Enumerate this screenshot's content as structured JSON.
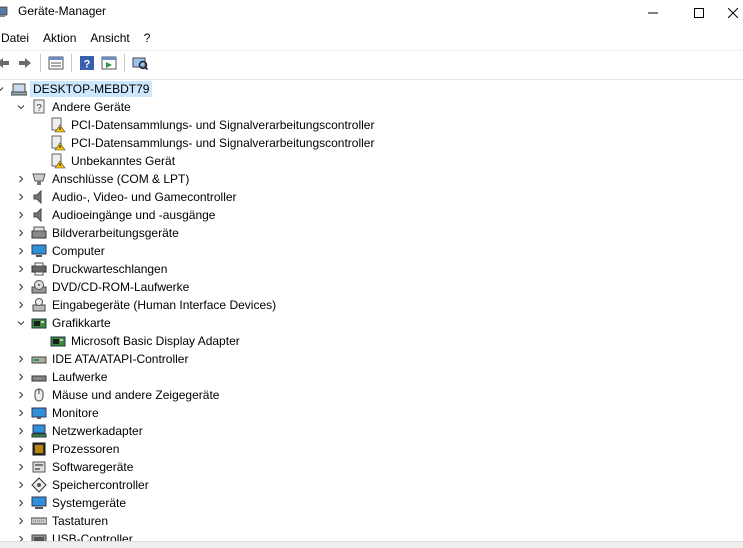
{
  "window": {
    "title": "Geräte-Manager",
    "min_symbol": "—",
    "max_symbol": "☐",
    "close_symbol": "✕"
  },
  "menu": {
    "items": [
      "Datei",
      "Aktion",
      "Ansicht",
      "?"
    ]
  },
  "toolbar": {
    "buttons": [
      "back-arrow-icon",
      "forward-arrow-icon",
      "properties-icon",
      "help-icon",
      "update-driver-icon",
      "scan-hardware-icon"
    ]
  },
  "tree": {
    "root": "DESKTOP-MEBDT79",
    "nodes": [
      {
        "label": "Andere Geräte",
        "expanded": true,
        "icon": "unknown-devices-icon",
        "children": [
          {
            "label": "PCI-Datensammlungs- und Signalverarbeitungscontroller",
            "icon": "warning-device-icon"
          },
          {
            "label": "PCI-Datensammlungs- und Signalverarbeitungscontroller",
            "icon": "warning-device-icon"
          },
          {
            "label": "Unbekanntes Gerät",
            "icon": "warning-device-icon"
          }
        ]
      },
      {
        "label": "Anschlüsse (COM & LPT)",
        "expanded": false,
        "icon": "port-icon"
      },
      {
        "label": "Audio-, Video- und Gamecontroller",
        "expanded": false,
        "icon": "speaker-icon"
      },
      {
        "label": "Audioeingänge und -ausgänge",
        "expanded": false,
        "icon": "speaker-icon"
      },
      {
        "label": "Bildverarbeitungsgeräte",
        "expanded": false,
        "icon": "scanner-icon"
      },
      {
        "label": "Computer",
        "expanded": false,
        "icon": "computer-icon"
      },
      {
        "label": "Druckwarteschlangen",
        "expanded": false,
        "icon": "printer-icon"
      },
      {
        "label": "DVD/CD-ROM-Laufwerke",
        "expanded": false,
        "icon": "dvd-drive-icon"
      },
      {
        "label": "Eingabegeräte (Human Interface Devices)",
        "expanded": false,
        "icon": "hid-icon"
      },
      {
        "label": "Grafikkarte",
        "expanded": true,
        "icon": "display-adapter-icon",
        "children": [
          {
            "label": "Microsoft Basic Display Adapter",
            "icon": "display-adapter-icon"
          }
        ]
      },
      {
        "label": "IDE ATA/ATAPI-Controller",
        "expanded": false,
        "icon": "ide-controller-icon"
      },
      {
        "label": "Laufwerke",
        "expanded": false,
        "icon": "disk-drive-icon"
      },
      {
        "label": "Mäuse und andere Zeigegeräte",
        "expanded": false,
        "icon": "mouse-icon"
      },
      {
        "label": "Monitore",
        "expanded": false,
        "icon": "monitor-icon"
      },
      {
        "label": "Netzwerkadapter",
        "expanded": false,
        "icon": "network-adapter-icon"
      },
      {
        "label": "Prozessoren",
        "expanded": false,
        "icon": "processor-icon"
      },
      {
        "label": "Softwaregeräte",
        "expanded": false,
        "icon": "software-device-icon"
      },
      {
        "label": "Speichercontroller",
        "expanded": false,
        "icon": "storage-controller-icon"
      },
      {
        "label": "Systemgeräte",
        "expanded": false,
        "icon": "system-device-icon"
      },
      {
        "label": "Tastaturen",
        "expanded": false,
        "icon": "keyboard-icon"
      },
      {
        "label": "USB-Controller",
        "expanded": false,
        "icon": "usb-controller-icon"
      }
    ]
  },
  "colors": {
    "selection": "#cce8ff",
    "warning": "#f4c20d",
    "monitor_blue": "#2f8fd8"
  }
}
